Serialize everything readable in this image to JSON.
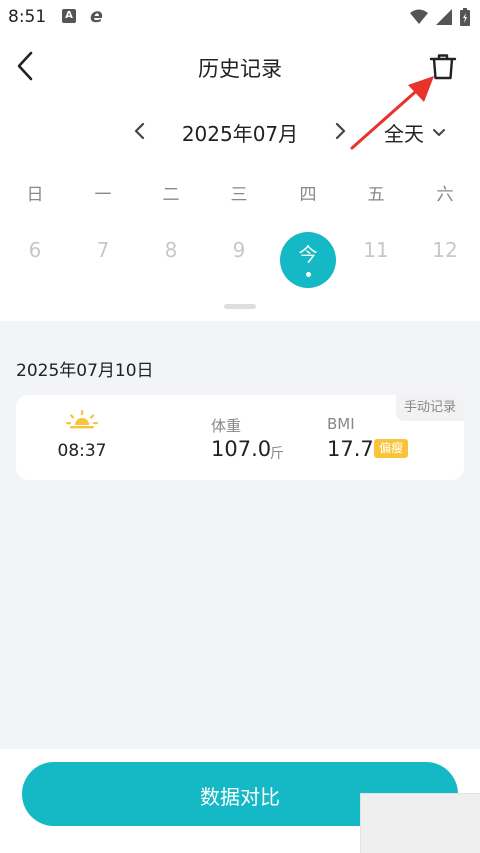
{
  "status_bar": {
    "time": "8:51",
    "notif_a": "A",
    "notif_e": "e"
  },
  "header": {
    "title": "历史记录"
  },
  "month_nav": {
    "month": "2025年07月",
    "range": "全天"
  },
  "weekdays": [
    "日",
    "一",
    "二",
    "三",
    "四",
    "五",
    "六"
  ],
  "dates": {
    "d1": "6",
    "d2": "7",
    "d3": "8",
    "d4": "9",
    "today": "今",
    "d6": "11",
    "d7": "12"
  },
  "record_group": {
    "date": "2025年07月10日",
    "record": {
      "source": "手动记录",
      "time": "08:37",
      "weight_label": "体重",
      "weight_value": "107.0",
      "weight_unit": "斤",
      "bmi_label": "BMI",
      "bmi_value": "17.7",
      "bmi_status": "偏瘦"
    }
  },
  "bottom": {
    "compare_label": "数据对比"
  },
  "colors": {
    "accent": "#15b8c5",
    "badge": "#f9c43a",
    "annotation": "#e8322b",
    "sun": "#f9c43a"
  }
}
